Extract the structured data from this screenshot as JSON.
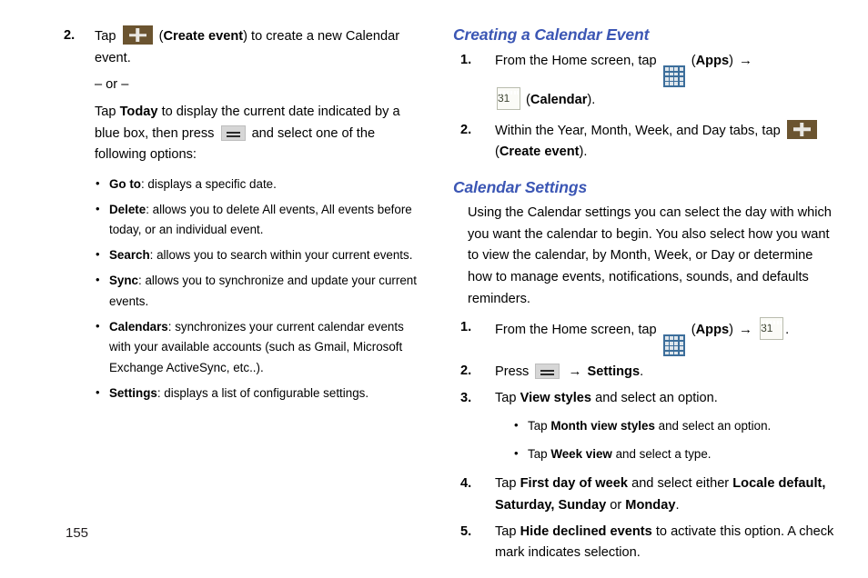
{
  "page": {
    "number": "155",
    "colors": {
      "heading": "#3b56b4",
      "plus_button": "#6b5430",
      "apps_icon": "#3c6e9b",
      "calendar_green": "#6aa832"
    }
  },
  "left_column": {
    "step": {
      "num": "2.",
      "line1_pre": "Tap",
      "icon": "create-event-plus-icon",
      "line1_bold": "Create event",
      "line1_post": ") to create a new Calendar event.",
      "or_divider": "– or –",
      "today_pre": "Tap",
      "today_bold": "Today",
      "today_mid": "to display the current date indicated by a blue box, then press",
      "menu_icon": "menu-icon",
      "today_post": "and select one of the following options:"
    },
    "options": [
      {
        "term": "Go to",
        "desc": ": displays a specific date."
      },
      {
        "term": "Delete",
        "desc": ": allows you to delete All events, All events before today, or an individual event."
      },
      {
        "term": "Search",
        "desc": ": allows you to search within your current events."
      },
      {
        "term": "Sync",
        "desc": ": allows you to synchronize and update your current events."
      },
      {
        "term": "Calendars",
        "desc": ": synchronizes your current calendar events with your available accounts (such as Gmail, Microsoft Exchange ActiveSync, etc..)."
      },
      {
        "term": "Settings",
        "desc": ": displays a list of configurable settings."
      }
    ]
  },
  "right_column": {
    "heading_creating": "Creating a Calendar Event",
    "creating_steps": [
      {
        "num": "1.",
        "pre": "From the Home screen, tap",
        "apps_icon": "apps-grid-icon",
        "apps_label": "Apps",
        "arrow": "→",
        "calendar_icon": "calendar-icon",
        "calendar_day": "31",
        "calendar_label": "Calendar",
        "post": ")."
      },
      {
        "num": "2.",
        "pre": "Within the Year, Month, Week, and Day tabs, tap",
        "plus_icon": "create-event-plus-icon",
        "bold": "Create event",
        "post": ")."
      }
    ],
    "heading_settings": "Calendar Settings",
    "settings_intro": "Using the Calendar settings you can select the day with which you want the calendar to begin. You also select how you want to view the calendar, by Month, Week, or Day or determine how to manage events, notifications, sounds, and defaults reminders.",
    "settings_steps": [
      {
        "num": "1.",
        "pre": "From the Home screen, tap",
        "apps_icon": "apps-grid-icon",
        "apps_label": "Apps",
        "arrow": "→",
        "calendar_icon": "calendar-icon",
        "calendar_day": "31",
        "post": "."
      },
      {
        "num": "2.",
        "pre": "Press",
        "menu_icon": "menu-icon",
        "arrow": "→",
        "bold": "Settings",
        "post": "."
      },
      {
        "num": "3.",
        "pre": "Tap",
        "bold": "View styles",
        "post": "and select an option.",
        "subs": [
          {
            "pre": "Tap",
            "bold": "Month view styles",
            "post": "and select an option."
          },
          {
            "pre": "Tap",
            "bold": "Week view",
            "post": "and select a type."
          }
        ]
      },
      {
        "num": "4.",
        "pre": "Tap",
        "bold": "First day of week",
        "mid": "and select either",
        "bold2": "Locale default, Saturday, Sunday",
        "mid2": "or",
        "bold3": "Monday",
        "post": "."
      },
      {
        "num": "5.",
        "pre": "Tap",
        "bold": "Hide declined events",
        "post": "to activate this option. A check mark indicates selection."
      }
    ]
  }
}
